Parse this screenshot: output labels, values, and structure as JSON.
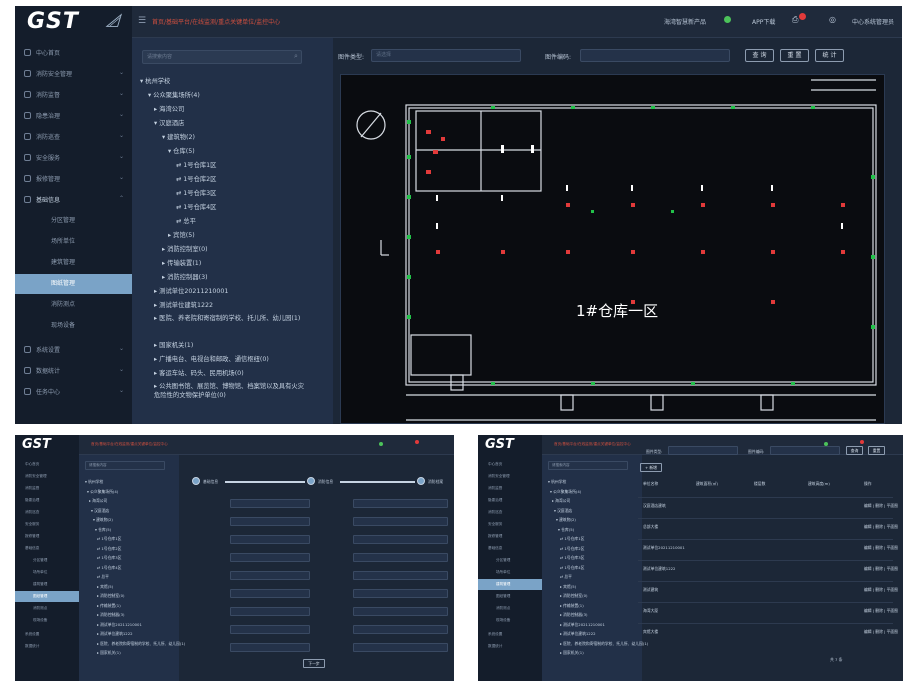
{
  "main": {
    "logo": "GST",
    "breadcrumb": "首页/基础平台/在线监测/重点关键单位/监控中心",
    "header_right": {
      "product_link": "海湾智慧新产品",
      "app_download": "APP下载",
      "user_center": "中心系统管理员"
    },
    "sidebar": [
      {
        "label": "中心首页"
      },
      {
        "label": "消防安全管理"
      },
      {
        "label": "消防监督"
      },
      {
        "label": "隐患治理"
      },
      {
        "label": "消防巡查"
      },
      {
        "label": "安全服务"
      },
      {
        "label": "报修管理"
      },
      {
        "label": "基础信息"
      },
      {
        "label": "系统设置"
      },
      {
        "label": "数据统计"
      },
      {
        "label": "任务中心"
      }
    ],
    "sidebar_sub": [
      {
        "label": "分区管理"
      },
      {
        "label": "场所单位"
      },
      {
        "label": "建筑管理"
      },
      {
        "label": "图纸管理"
      },
      {
        "label": "消防测点"
      },
      {
        "label": "现场设备"
      }
    ],
    "tree": {
      "search_placeholder": "请搜索内容",
      "nodes": [
        {
          "label": "▾ 杭州学校"
        },
        {
          "label": "▾ 公众聚集场所(4)"
        },
        {
          "label": "▸ 海湾公司"
        },
        {
          "label": "▾ 汉庭酒店"
        },
        {
          "label": "▾ 建筑物(2)"
        },
        {
          "label": "▾ 仓库(5)"
        },
        {
          "label": "⇄ 1号仓库1区"
        },
        {
          "label": "⇄ 1号仓库2区"
        },
        {
          "label": "⇄ 1号仓库3区"
        },
        {
          "label": "⇄ 1号仓库4区"
        },
        {
          "label": "⇄ 总平"
        },
        {
          "label": "▸ 宾馆(5)"
        },
        {
          "label": "▸ 消防控制室(0)"
        },
        {
          "label": "▸ 传输装置(1)"
        },
        {
          "label": "▸ 消防控制器(3)"
        },
        {
          "label": "▸ 测试单位20211210001"
        },
        {
          "label": "▸ 测试单位建筑1222"
        },
        {
          "label": "▸ 医院、养老院和寄宿制的学校、托儿所、幼儿园(1)"
        },
        {
          "label": "▸ 国家机关(1)"
        },
        {
          "label": "▸ 广播电台、电视台和邮政、通信枢纽(0)"
        },
        {
          "label": "▸ 客运车站、码头、民用机场(0)"
        },
        {
          "label": "▸ 公共图书馆、展览馆、博物馆、档案馆以及具有火灾危险性的文物保护单位(0)"
        }
      ]
    },
    "filters": {
      "type_label": "图件类型:",
      "type_placeholder": "请选择",
      "code_label": "图件编码:",
      "code_placeholder": ""
    },
    "buttons": {
      "query": "查 询",
      "reset": "重 置",
      "stats": "统 计"
    },
    "cad_label": "1#仓库一区"
  },
  "form_shot": {
    "logo": "GST",
    "breadcrumb": "首页/基础平台/在线监测/重点关键单位/监控中心",
    "steps": [
      "基础信息",
      "消防信息",
      "消防档案"
    ],
    "submit": "下一步"
  },
  "table_shot": {
    "logo": "GST",
    "breadcrumb": "首页/基础平台/在线监测/重点关键单位/监控中心",
    "add_btn": "+ 新增",
    "query_btn": "查询",
    "reset_btn": "重置",
    "columns": [
      "单位名称",
      "建筑面积(㎡)",
      "楼层数",
      "建筑高度(m)",
      "操作"
    ],
    "rows": [
      {
        "name": "汉庭酒店建筑",
        "ops": "编辑 | 删除 | 平面图"
      },
      {
        "name": "总部大楼",
        "ops": "编辑 | 删除 | 平面图"
      },
      {
        "name": "测试单位20211210001",
        "ops": "编辑 | 删除 | 平面图"
      },
      {
        "name": "测试单位建筑1222",
        "ops": "编辑 | 删除 | 平面图"
      },
      {
        "name": "测试建筑",
        "ops": "编辑 | 删除 | 平面图"
      },
      {
        "name": "海湾大厦",
        "ops": "编辑 | 删除 | 平面图"
      },
      {
        "name": "宾馆大楼",
        "ops": "编辑 | 删除 | 平面图"
      }
    ],
    "pagination": "共 7 条"
  }
}
